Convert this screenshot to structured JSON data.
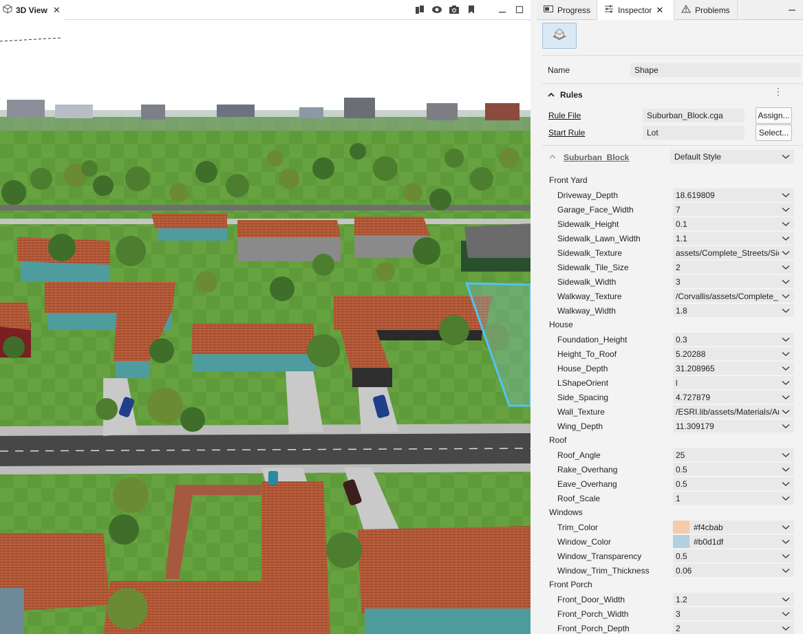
{
  "view_tab": {
    "label": "3D View",
    "close": "✕"
  },
  "view_tools": [
    "layers-icon",
    "eye-icon",
    "camera-icon",
    "bookmark-icon"
  ],
  "window_controls": [
    "minimize-icon",
    "maximize-icon"
  ],
  "inspector_tabs": [
    {
      "label": "Progress",
      "icon": "progress-icon"
    },
    {
      "label": "Inspector",
      "icon": "sliders-icon",
      "close": "✕"
    },
    {
      "label": "Problems",
      "icon": "warning-icon"
    }
  ],
  "name_row": {
    "label": "Name",
    "value": "Shape"
  },
  "rules": {
    "title": "Rules",
    "rule_file": {
      "label": "Rule File",
      "value": "Suburban_Block.cga",
      "button": "Assign..."
    },
    "start_rule": {
      "label": "Start Rule",
      "value": "Lot",
      "button": "Select..."
    }
  },
  "style": {
    "name": "Suburban_Block",
    "value": "Default Style"
  },
  "groups": [
    {
      "name": "Front Yard",
      "attrs": [
        {
          "label": "Driveway_Depth",
          "value": "18.619809"
        },
        {
          "label": "Garage_Face_Width",
          "value": "7"
        },
        {
          "label": "Sidewalk_Height",
          "value": "0.1"
        },
        {
          "label": "Sidewalk_Lawn_Width",
          "value": "1.1"
        },
        {
          "label": "Sidewalk_Texture",
          "value": "assets/Complete_Streets/Sic"
        },
        {
          "label": "Sidewalk_Tile_Size",
          "value": "2"
        },
        {
          "label": "Sidewalk_Width",
          "value": "3"
        },
        {
          "label": "Walkway_Texture",
          "value": "/Corvallis/assets/Complete_"
        },
        {
          "label": "Walkway_Width",
          "value": "1.8"
        }
      ]
    },
    {
      "name": "House",
      "attrs": [
        {
          "label": "Foundation_Height",
          "value": "0.3"
        },
        {
          "label": "Height_To_Roof",
          "value": "5.20288"
        },
        {
          "label": "House_Depth",
          "value": "31.208965"
        },
        {
          "label": "LShapeOrient",
          "value": "l"
        },
        {
          "label": "Side_Spacing",
          "value": "4.727879"
        },
        {
          "label": "Wall_Texture",
          "value": "/ESRI.lib/assets/Materials/Ar"
        },
        {
          "label": "Wing_Depth",
          "value": "11.309179"
        }
      ]
    },
    {
      "name": "Roof",
      "attrs": [
        {
          "label": "Roof_Angle",
          "value": "25"
        },
        {
          "label": "Rake_Overhang",
          "value": "0.5"
        },
        {
          "label": "Eave_Overhang",
          "value": "0.5"
        },
        {
          "label": "Roof_Scale",
          "value": "1"
        }
      ]
    },
    {
      "name": "Windows",
      "attrs": [
        {
          "label": "Trim_Color",
          "value": "#f4cbab",
          "swatch": "#f4cbab"
        },
        {
          "label": "Window_Color",
          "value": "#b0d1df",
          "swatch": "#b0d1df"
        },
        {
          "label": "Window_Transparency",
          "value": "0.5"
        },
        {
          "label": "Window_Trim_Thickness",
          "value": "0.06"
        }
      ]
    },
    {
      "name": "Front Porch",
      "attrs": [
        {
          "label": "Front_Door_Width",
          "value": "1.2"
        },
        {
          "label": "Front_Porch_Width",
          "value": "3"
        },
        {
          "label": "Front_Porch_Depth",
          "value": "2"
        }
      ]
    }
  ],
  "colors": {
    "grass": "#5f9a3a",
    "roof": "#b85a3a",
    "wall": "#4f9c9f",
    "road": "#4a4a4a",
    "sidewalk": "#c8c8c8",
    "selection": "#4fc3f7",
    "accent": "#dbe8f5"
  }
}
